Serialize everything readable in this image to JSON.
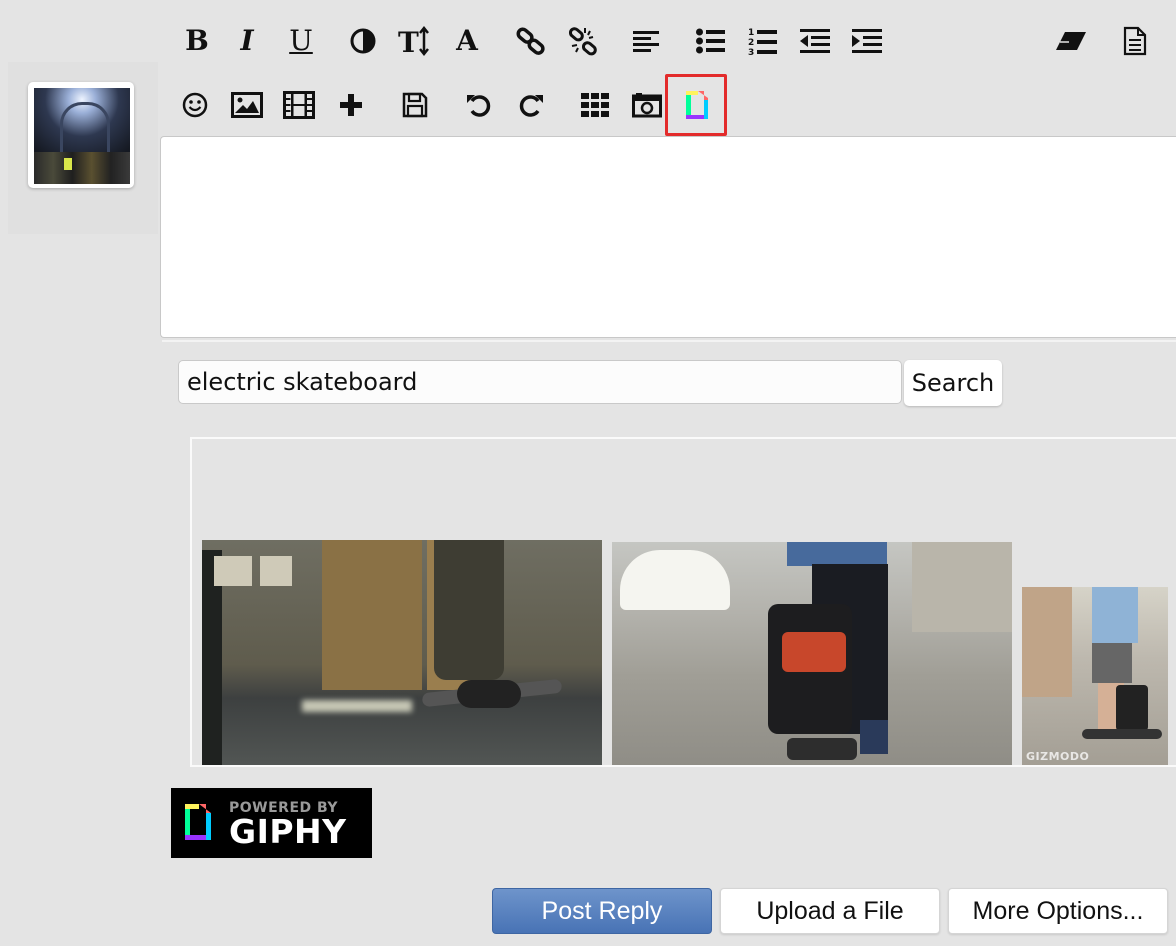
{
  "toolbar": {
    "row1": [
      {
        "name": "bold-button",
        "icon": "bold-icon",
        "glyph": "B"
      },
      {
        "name": "italic-button",
        "icon": "italic-icon",
        "glyph": "I"
      },
      {
        "name": "underline-button",
        "icon": "underline-icon",
        "glyph": "U"
      },
      {
        "name": "color-button",
        "icon": "contrast-icon"
      },
      {
        "name": "font-size-button",
        "icon": "text-height-icon"
      },
      {
        "name": "font-button",
        "icon": "font-icon",
        "glyph": "A"
      },
      {
        "name": "link-button",
        "icon": "link-icon"
      },
      {
        "name": "unlink-button",
        "icon": "unlink-icon"
      },
      {
        "name": "align-left-button",
        "icon": "align-left-icon"
      },
      {
        "name": "bullet-list-button",
        "icon": "list-ul-icon"
      },
      {
        "name": "numbered-list-button",
        "icon": "list-ol-icon"
      },
      {
        "name": "outdent-button",
        "icon": "outdent-icon"
      },
      {
        "name": "indent-button",
        "icon": "indent-icon"
      },
      {
        "name": "remove-format-button",
        "icon": "eraser-icon"
      },
      {
        "name": "source-button",
        "icon": "document-icon"
      }
    ],
    "row2": [
      {
        "name": "emoji-button",
        "icon": "smiley-icon"
      },
      {
        "name": "image-button",
        "icon": "image-icon"
      },
      {
        "name": "video-button",
        "icon": "film-icon"
      },
      {
        "name": "insert-button",
        "icon": "plus-icon"
      },
      {
        "name": "save-draft-button",
        "icon": "floppy-icon"
      },
      {
        "name": "undo-button",
        "icon": "undo-icon"
      },
      {
        "name": "redo-button",
        "icon": "redo-icon"
      },
      {
        "name": "gallery-button",
        "icon": "grid-icon"
      },
      {
        "name": "media-button",
        "icon": "camera-icon"
      },
      {
        "name": "giphy-button",
        "icon": "giphy-icon",
        "highlighted": true
      }
    ]
  },
  "editor": {
    "content": ""
  },
  "search": {
    "query": "electric skateboard",
    "button_label": "Search"
  },
  "results": {
    "items": [
      {
        "name": "gif-onewheel",
        "description": "one-wheel electric skateboard"
      },
      {
        "name": "gif-backpack",
        "description": "backpack on skateboard"
      },
      {
        "name": "gif-rider",
        "description": "rider on electric skateboard",
        "watermark": "GIZMODO"
      }
    ]
  },
  "giphy_badge": {
    "powered_by": "POWERED BY",
    "brand": "GIPHY"
  },
  "actions": {
    "post_reply": "Post Reply",
    "upload_file": "Upload a File",
    "more_options": "More Options..."
  },
  "colors": {
    "highlight": "#e32b2b",
    "primary_button": "#4873b5",
    "background": "#e4e4e4"
  }
}
